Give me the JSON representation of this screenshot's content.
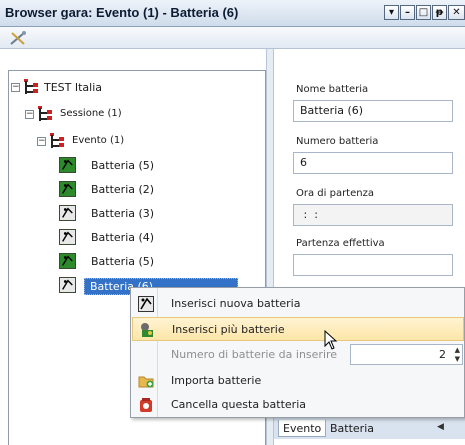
{
  "window": {
    "title": "Browser gara: Evento (1) - Batteria (6)",
    "buttons": [
      "▾",
      "–",
      "□",
      "ᵽ",
      "✕"
    ]
  },
  "toolbar": {
    "tools_icon": "tools-icon"
  },
  "tree": {
    "root": "TEST Italia",
    "session": "Sessione (1)",
    "event": "Evento (1)",
    "batteries": [
      {
        "label": "Batteria (5)",
        "icon": "green"
      },
      {
        "label": "Batteria (2)",
        "icon": "green"
      },
      {
        "label": "Batteria (3)",
        "icon": "gray"
      },
      {
        "label": "Batteria (4)",
        "icon": "gray"
      },
      {
        "label": "Batteria (5)",
        "icon": "green"
      },
      {
        "label": "Batteria (6)",
        "icon": "gray",
        "selected": true
      }
    ],
    "expander_symbol": "−"
  },
  "details": {
    "name_label": "Nome batteria",
    "name_value": "Batteria (6)",
    "number_label": "Numero batteria",
    "number_value": "6",
    "start_label": "Ora di partenza",
    "start_value": " :  :",
    "actual_label": "Partenza effettiva",
    "actual_value": ""
  },
  "tabs": {
    "evento": "Evento",
    "batteria": "Batteria",
    "scroll_left": "◀"
  },
  "context_menu": {
    "items": [
      {
        "label": "Inserisci nuova batteria",
        "icon": "battery-icon"
      },
      {
        "label": "Inserisci più batterie",
        "icon": "multi-battery-icon",
        "highlighted": true
      },
      {
        "label": "Numero di batterie da inserire",
        "dimmed": true,
        "spinner_value": "2"
      },
      {
        "label": "Importa batterie",
        "icon": "import-icon"
      },
      {
        "label": "Cancella questa batteria",
        "icon": "delete-icon"
      }
    ]
  }
}
